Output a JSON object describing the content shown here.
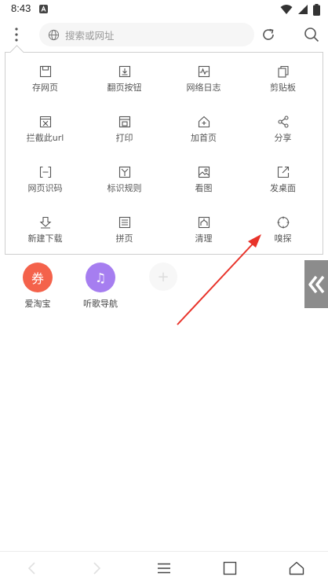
{
  "status_bar": {
    "time": "8:43"
  },
  "toolbar": {
    "search_placeholder": "搜索或网址"
  },
  "menu": {
    "items": [
      {
        "label": "存网页",
        "icon": "save-page-icon"
      },
      {
        "label": "翻页按钮",
        "icon": "page-turn-icon"
      },
      {
        "label": "网络日志",
        "icon": "network-log-icon"
      },
      {
        "label": "剪贴板",
        "icon": "clipboard-icon"
      },
      {
        "label": "拦截此url",
        "icon": "block-url-icon"
      },
      {
        "label": "打印",
        "icon": "print-icon"
      },
      {
        "label": "加首页",
        "icon": "add-homepage-icon"
      },
      {
        "label": "分享",
        "icon": "share-icon"
      },
      {
        "label": "网页识码",
        "icon": "scan-code-icon"
      },
      {
        "label": "标识规则",
        "icon": "mark-rule-icon"
      },
      {
        "label": "看图",
        "icon": "view-image-icon"
      },
      {
        "label": "发桌面",
        "icon": "send-desktop-icon"
      },
      {
        "label": "新建下载",
        "icon": "new-download-icon"
      },
      {
        "label": "拼页",
        "icon": "merge-page-icon"
      },
      {
        "label": "清理",
        "icon": "clean-icon"
      },
      {
        "label": "嗅探",
        "icon": "sniff-icon"
      }
    ]
  },
  "shortcuts": [
    {
      "label": "爱淘宝",
      "glyph": "券",
      "color": "#f4624b"
    },
    {
      "label": "听歌导航",
      "glyph": "♫",
      "color": "#a67ef0"
    }
  ],
  "add_shortcut_glyph": "+",
  "colors": {
    "annotation_arrow": "#e8332a",
    "side_tab": "#8c8c8c"
  }
}
